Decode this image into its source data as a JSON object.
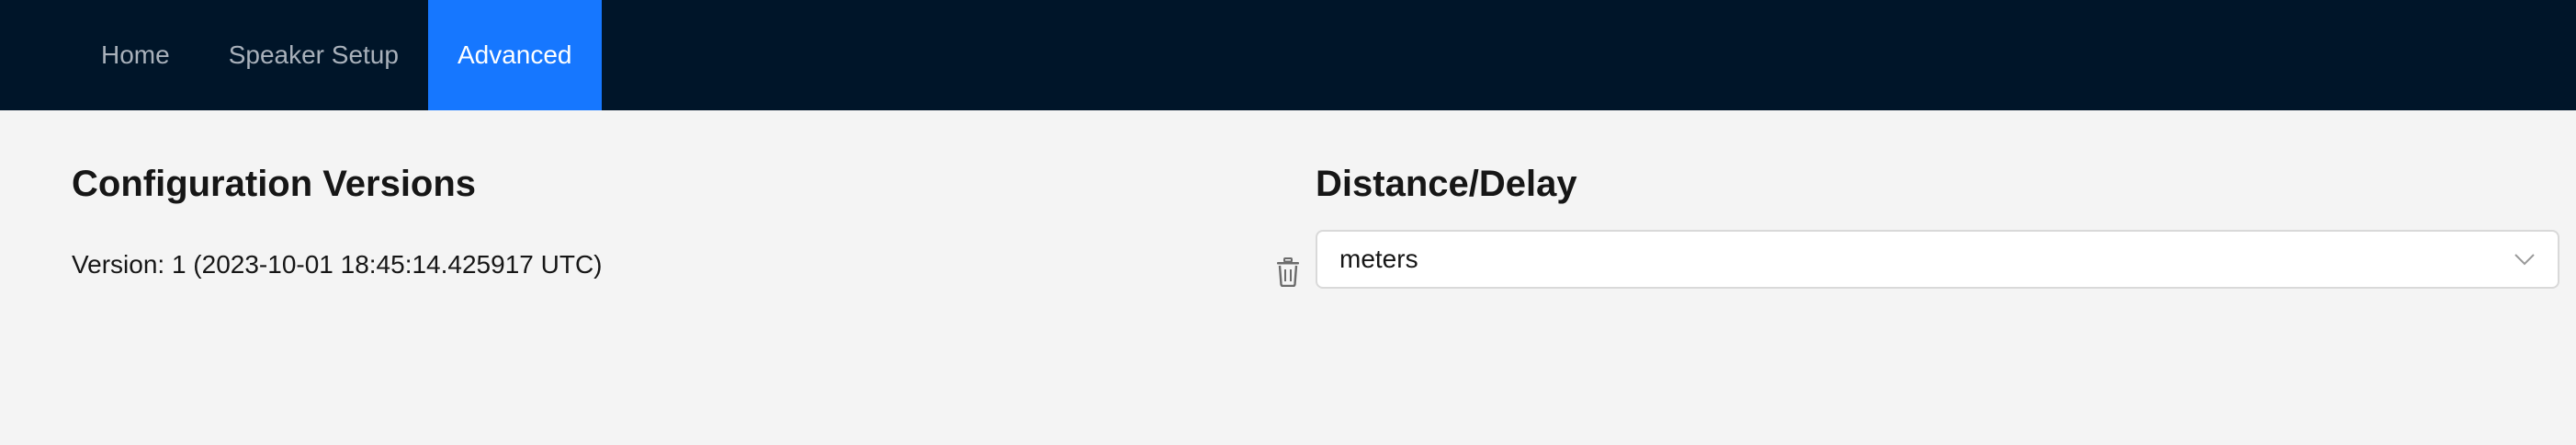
{
  "nav": {
    "items": [
      {
        "label": "Home",
        "active": false
      },
      {
        "label": "Speaker Setup",
        "active": false
      },
      {
        "label": "Advanced",
        "active": true
      }
    ]
  },
  "config_versions": {
    "title": "Configuration Versions",
    "versions": [
      {
        "label": "Version: 1 (2023-10-01 18:45:14.425917 UTC)",
        "icon": "trash-icon"
      }
    ]
  },
  "distance_delay": {
    "title": "Distance/Delay",
    "unit_select": {
      "value": "meters",
      "icon": "chevron-down-icon"
    }
  },
  "colors": {
    "nav_bg": "#001529",
    "nav_active": "#1677ff",
    "page_bg": "#f4f4f4"
  }
}
